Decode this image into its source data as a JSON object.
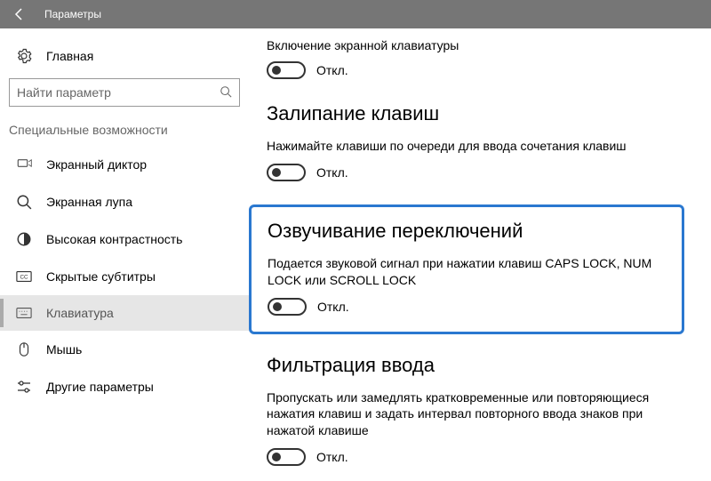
{
  "titlebar": {
    "title": "Параметры"
  },
  "sidebar": {
    "home": "Главная",
    "search_placeholder": "Найти параметр",
    "category": "Специальные возможности",
    "items": [
      {
        "label": "Экранный диктор"
      },
      {
        "label": "Экранная лупа"
      },
      {
        "label": "Высокая контрастность"
      },
      {
        "label": "Скрытые субтитры"
      },
      {
        "label": "Клавиатура"
      },
      {
        "label": "Мышь"
      },
      {
        "label": "Другие параметры"
      }
    ]
  },
  "content": {
    "osk": {
      "sub": "Включение экранной клавиатуры",
      "toggle": "Откл."
    },
    "sticky": {
      "heading": "Залипание клавиш",
      "desc": "Нажимайте клавиши по очереди для ввода сочетания клавиш",
      "toggle": "Откл."
    },
    "togglekeys": {
      "heading": "Озвучивание переключений",
      "desc": "Подается звуковой сигнал при нажатии клавиш CAPS LOCK, NUM LOCK или SCROLL LOCK",
      "toggle": "Откл."
    },
    "filter": {
      "heading": "Фильтрация ввода",
      "desc": "Пропускать или замедлять кратковременные или повторяющиеся нажатия клавиш и задать интервал повторного ввода знаков при нажатой клавише",
      "toggle": "Откл."
    }
  }
}
